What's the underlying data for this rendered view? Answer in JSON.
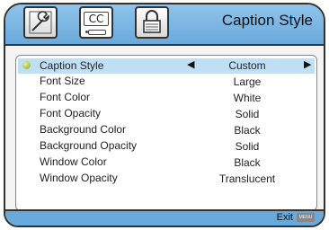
{
  "header": {
    "title": "Caption Style",
    "tabs": [
      {
        "icon": "wrench-icon"
      },
      {
        "icon": "closed-caption-icon",
        "text": "CC"
      },
      {
        "icon": "lock-icon"
      }
    ]
  },
  "menu": {
    "items": [
      {
        "label": "Caption Style",
        "value": "Custom"
      },
      {
        "label": "Font Size",
        "value": "Large"
      },
      {
        "label": "Font Color",
        "value": "White"
      },
      {
        "label": "Font Opacity",
        "value": "Solid"
      },
      {
        "label": "Background Color",
        "value": "Black"
      },
      {
        "label": "Background Opacity",
        "value": "Solid"
      },
      {
        "label": "Window Color",
        "value": "Black"
      },
      {
        "label": "Window Opacity",
        "value": "Translucent"
      }
    ],
    "left_arrow": "◀",
    "right_arrow": "▶"
  },
  "footer": {
    "exit_label": "Exit",
    "menu_key": "MENU"
  },
  "colors": {
    "header_blue": "#6aa9dc",
    "selection": "#bfe0f4",
    "bullet": "#8ba41e"
  }
}
